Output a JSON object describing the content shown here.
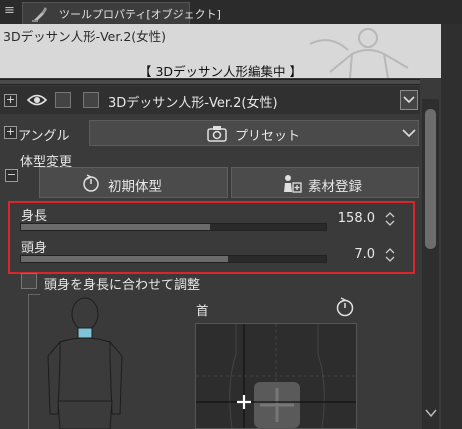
{
  "panel": {
    "tab_title": "ツールプロパティ[オブジェクト]",
    "menu_glyph": "≡",
    "icons": [
      "menu-icon",
      "tool-icon",
      "eye-icon",
      "dropdown-arrow-icon",
      "camera-icon",
      "chevron-down-icon",
      "reset-icon",
      "register-material-icon",
      "spin-arrows-icon",
      "checkbox-icon",
      "crosshair-icon"
    ]
  },
  "banner": {
    "title": "3Dデッサン人形-Ver.2(女性)",
    "status": "【 3Dデッサン人形編集中 】"
  },
  "model_row": {
    "expand": "+",
    "name": "3Dデッサン人形-Ver.2(女性)"
  },
  "angle": {
    "expand": "+",
    "label": "アングル",
    "preset_label": "プリセット"
  },
  "body_shape": {
    "section_title": "体型変更",
    "collapse": "−",
    "initial_button": "初期体型",
    "register_button": "素材登録"
  },
  "sliders": {
    "height": {
      "label": "身長",
      "value": "158.0",
      "fill_fraction": 0.62
    },
    "head": {
      "label": "頭身",
      "value": "7.0",
      "fill_fraction": 0.68
    }
  },
  "fit_option": {
    "label": "頭身を身長に合わせて調整",
    "checked": false
  },
  "neck": {
    "label": "首"
  },
  "colors": {
    "highlight": "#d8262a",
    "background": "#3a3a3a",
    "slider_fill": "#6a6a6a"
  }
}
